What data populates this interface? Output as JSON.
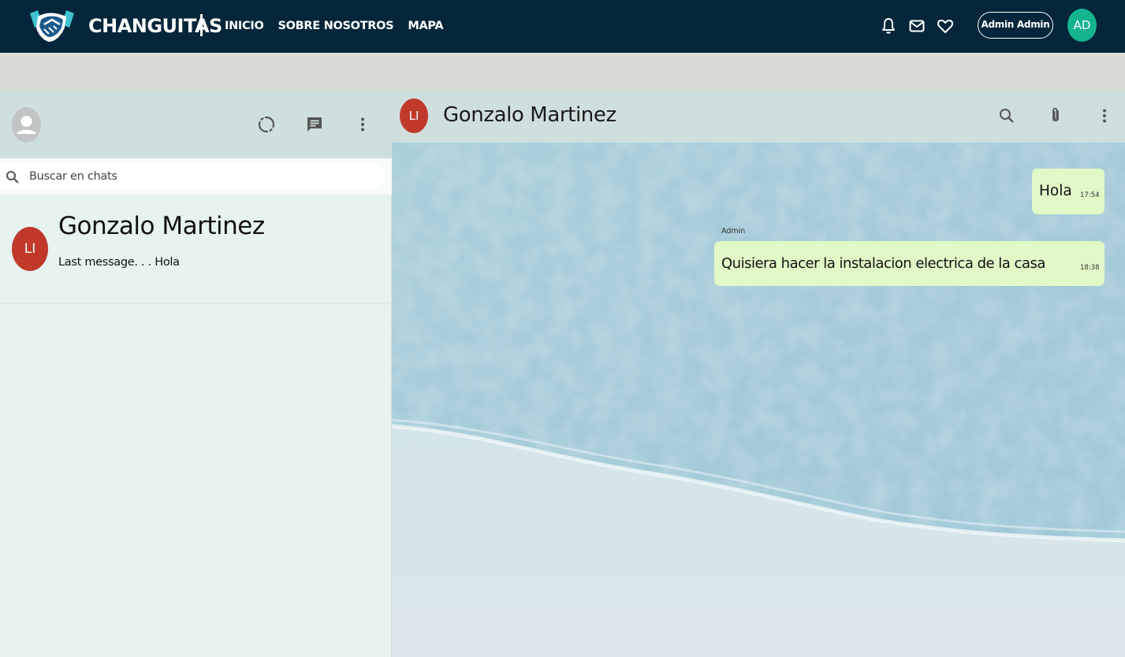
{
  "navbar": {
    "brand": "CHANGUITAS",
    "links": [
      "INICIO",
      "SOBRE NOSOTROS",
      "MAPA"
    ],
    "icons": [
      "bell-icon",
      "mail-icon",
      "heart-icon"
    ],
    "user_button": "Admin Admin",
    "user_initials": "AD"
  },
  "sidebar": {
    "header_icons": [
      "status-icon",
      "new-chat-icon",
      "menu-icon"
    ],
    "search": {
      "placeholder": "Buscar en chats",
      "value": ""
    },
    "chats": [
      {
        "initials": "LI",
        "name": "Gonzalo Martinez",
        "last_message": "Last message. . . Hola"
      }
    ]
  },
  "conversation": {
    "contact_initials": "LI",
    "contact_name": "Gonzalo Martinez",
    "header_icons": [
      "search-icon",
      "attach-icon",
      "menu-icon"
    ],
    "messages": [
      {
        "sender": "",
        "text": "Hola",
        "time": "17:54"
      },
      {
        "sender": "Admin",
        "text": "Quisiera hacer la instalacion electrica de la casa",
        "time": "18:38"
      }
    ]
  },
  "colors": {
    "navbar_bg": "#04263a",
    "avatar_red": "#c0392b",
    "user_avatar_green": "#14b48e",
    "bubble_green": "#e1f8c7",
    "panel_header": "#cfdfde"
  }
}
